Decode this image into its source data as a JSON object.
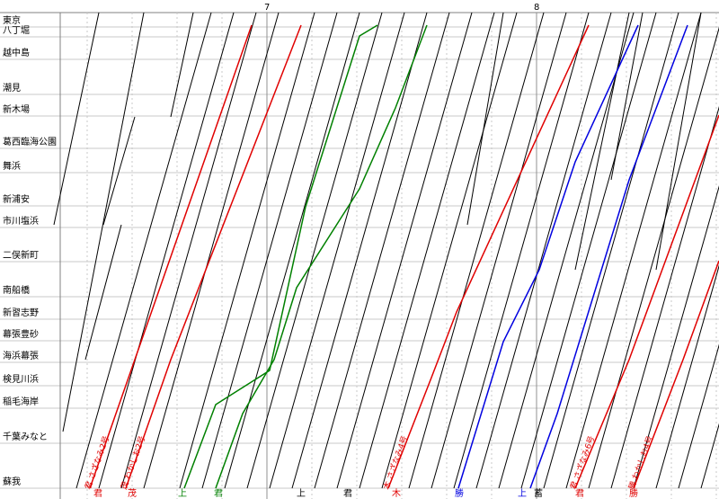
{
  "chart_data": {
    "type": "line",
    "title": "",
    "xlabel": "",
    "ylabel": "",
    "hours": [
      "7",
      "8"
    ],
    "stations": [
      "東京",
      "八丁堀",
      "越中島",
      "潮見",
      "新木場",
      "葛西臨海公園",
      "舞浜",
      "新浦安",
      "市川塩浜",
      "二俣新町",
      "南船橋",
      "新習志野",
      "幕張豊砂",
      "海浜幕張",
      "検見川浜",
      "稲毛海岸",
      "千葉みなと",
      "蘇我"
    ],
    "colors": {
      "local": "#000000",
      "express_red": "#e00000",
      "express_green": "#008000",
      "express_blue": "#0000e0"
    },
    "train_labels": [
      "君 さざなみ2号",
      "茂 わかしお2号",
      "木 さざなみ4号",
      "君 さざなみ6号",
      "勝 わかしお4号"
    ],
    "end_labels": [
      "君",
      "茂",
      "上",
      "君",
      "上",
      "君",
      "木",
      "勝",
      "上",
      "蓄",
      "君",
      "勝"
    ]
  }
}
